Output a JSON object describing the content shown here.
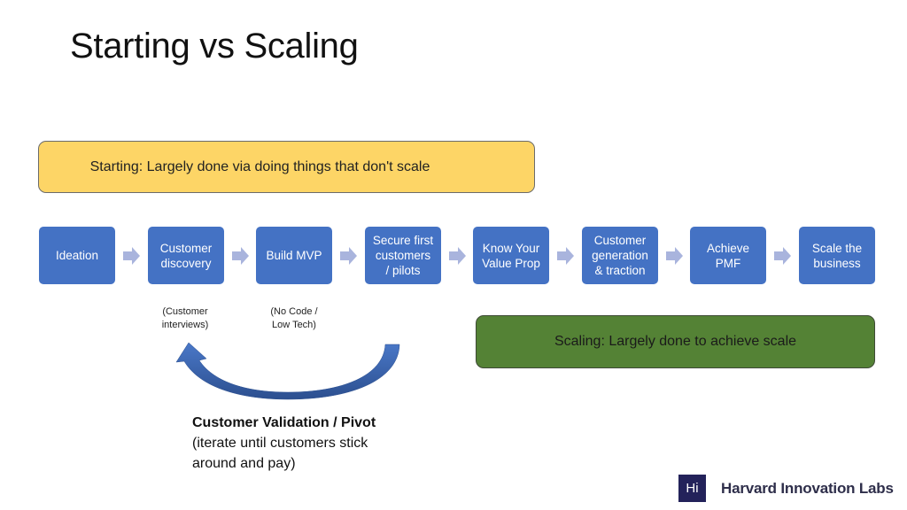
{
  "title": "Starting vs Scaling",
  "starting_box": {
    "label": "Starting: Largely done via doing things that don't scale",
    "color": "#fdd566"
  },
  "scaling_box": {
    "label": "Scaling: Largely done to achieve scale",
    "color": "#548235"
  },
  "steps": [
    {
      "label": "Ideation"
    },
    {
      "label": "Customer\ndiscovery"
    },
    {
      "label": "Build MVP"
    },
    {
      "label": "Secure first\ncustomers\n/ pilots"
    },
    {
      "label": "Know Your\nValue Prop"
    },
    {
      "label": "Customer\ngeneration\n& traction"
    },
    {
      "label": "Achieve\nPMF"
    },
    {
      "label": "Scale the\nbusiness"
    }
  ],
  "step_color": "#4472c4",
  "arrow_color": "#a9b4dd",
  "notes": {
    "discovery": "(Customer\ninterviews)",
    "mvp": "(No Code /\nLow Tech)"
  },
  "loop": {
    "heading": "Customer Validation / Pivot",
    "description": "(iterate until customers stick around and pay)"
  },
  "logo": {
    "mark": "Hi",
    "name": "Harvard Innovation Labs"
  }
}
